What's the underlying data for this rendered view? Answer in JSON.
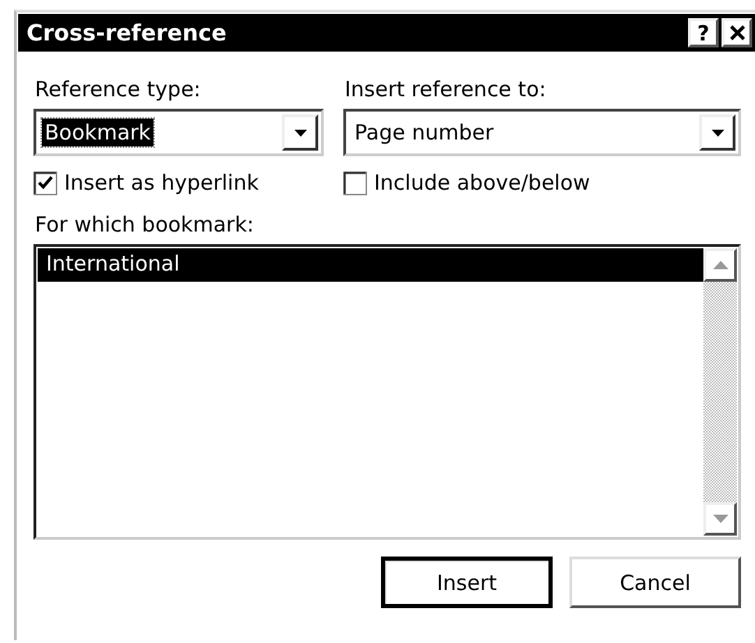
{
  "window": {
    "title": "Cross-reference",
    "help_button": "?"
  },
  "reference_type": {
    "label": "Reference type:",
    "value": "Bookmark",
    "focused": true
  },
  "insert_reference_to": {
    "label": "Insert reference to:",
    "value": "Page number",
    "focused": false
  },
  "checkboxes": [
    {
      "label": "Insert as hyperlink",
      "checked": true
    },
    {
      "label": "Include above/below",
      "checked": false
    }
  ],
  "bookmark_list": {
    "label": "For which bookmark:",
    "items": [
      {
        "label": "International",
        "selected": true
      }
    ]
  },
  "buttons": [
    {
      "label": "Insert",
      "default": true
    },
    {
      "label": "Cancel",
      "default": false
    }
  ]
}
